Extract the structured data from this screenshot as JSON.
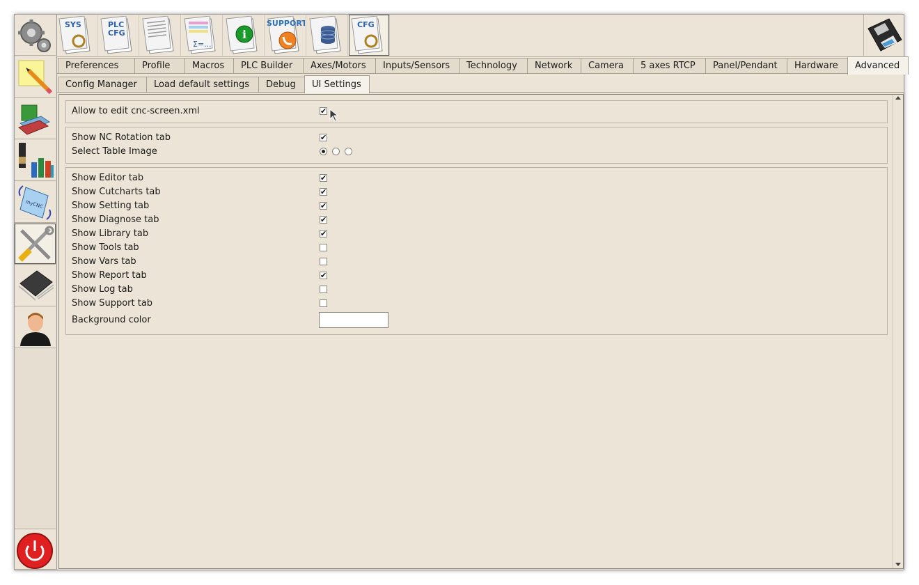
{
  "main_tabs": [
    {
      "label": "Preferences",
      "active": false
    },
    {
      "label": "Profile",
      "active": false
    },
    {
      "label": "Macros",
      "active": false
    },
    {
      "label": "PLC Builder",
      "active": false
    },
    {
      "label": "Axes/Motors",
      "active": false
    },
    {
      "label": "Inputs/Sensors",
      "active": false
    },
    {
      "label": "Technology",
      "active": false
    },
    {
      "label": "Network",
      "active": false
    },
    {
      "label": "Camera",
      "active": false
    },
    {
      "label": "5 axes RTCP",
      "active": false
    },
    {
      "label": "Panel/Pendant",
      "active": false
    },
    {
      "label": "Hardware",
      "active": false
    },
    {
      "label": "Advanced",
      "active": true
    }
  ],
  "sub_tabs": [
    {
      "label": "Config Manager",
      "active": false
    },
    {
      "label": "Load default settings",
      "active": false
    },
    {
      "label": "Debug",
      "active": false
    },
    {
      "label": "UI Settings",
      "active": true
    }
  ],
  "toolbar": {
    "sys_label": "SYS",
    "plc_label_1": "PLC",
    "plc_label_2": "CFG",
    "formula_label": "Σ=...",
    "support_label": "SUPPORT",
    "cfg_label": "CFG"
  },
  "group1": {
    "allow_edit_label": "Allow to edit cnc-screen.xml",
    "allow_edit_checked": true
  },
  "group2": {
    "nc_rotation_label": "Show NC Rotation tab",
    "nc_rotation_checked": true,
    "table_image_label": "Select Table Image",
    "table_image_selected": 0
  },
  "group3": {
    "items": [
      {
        "label": "Show Editor tab",
        "checked": true
      },
      {
        "label": "Show Cutcharts tab",
        "checked": true
      },
      {
        "label": "Show Setting tab",
        "checked": true
      },
      {
        "label": "Show Diagnose tab",
        "checked": true
      },
      {
        "label": "Show Library tab",
        "checked": true
      },
      {
        "label": "Show Tools tab",
        "checked": false
      },
      {
        "label": "Show Vars tab",
        "checked": false
      },
      {
        "label": "Show Report tab",
        "checked": true
      },
      {
        "label": "Show Log tab",
        "checked": false
      },
      {
        "label": "Show Support tab",
        "checked": false
      }
    ],
    "background_color_label": "Background color",
    "background_color_value": "#ffffff"
  },
  "sidebar_icons": [
    "settings-gears-icon",
    "edit-notes-icon",
    "books-icon",
    "tools-library-icon",
    "rotation-mycnc-icon",
    "config-tools-icon",
    "hardware-chip-icon",
    "user-icon",
    "power-icon"
  ]
}
